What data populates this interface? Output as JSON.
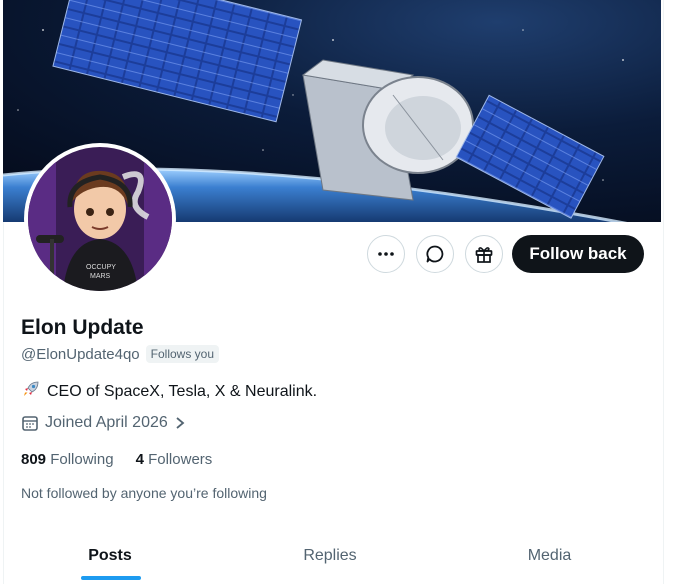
{
  "profile": {
    "display_name": "Elon Update",
    "handle": "@ElonUpdate4qo",
    "follows_you_badge": "Follows you",
    "bio_emoji": "rocket-icon",
    "bio": "CEO of SpaceX, Tesla, X & Neuralink.",
    "joined": "Joined April 2026",
    "following_count": "809",
    "following_label": "Following",
    "followers_count": "4",
    "followers_label": "Followers",
    "mutuals_text": "Not followed by anyone you’re following"
  },
  "actions": {
    "more_icon": "ellipsis-icon",
    "message_icon": "message-bubble-icon",
    "gift_icon": "gift-icon",
    "follow_label": "Follow back"
  },
  "tabs": [
    {
      "label": "Posts",
      "active": true
    },
    {
      "label": "Replies",
      "active": false
    },
    {
      "label": "Media",
      "active": false
    }
  ],
  "colors": {
    "accent": "#1d9bf0",
    "text_primary": "#0f1419",
    "text_secondary": "#536471"
  }
}
